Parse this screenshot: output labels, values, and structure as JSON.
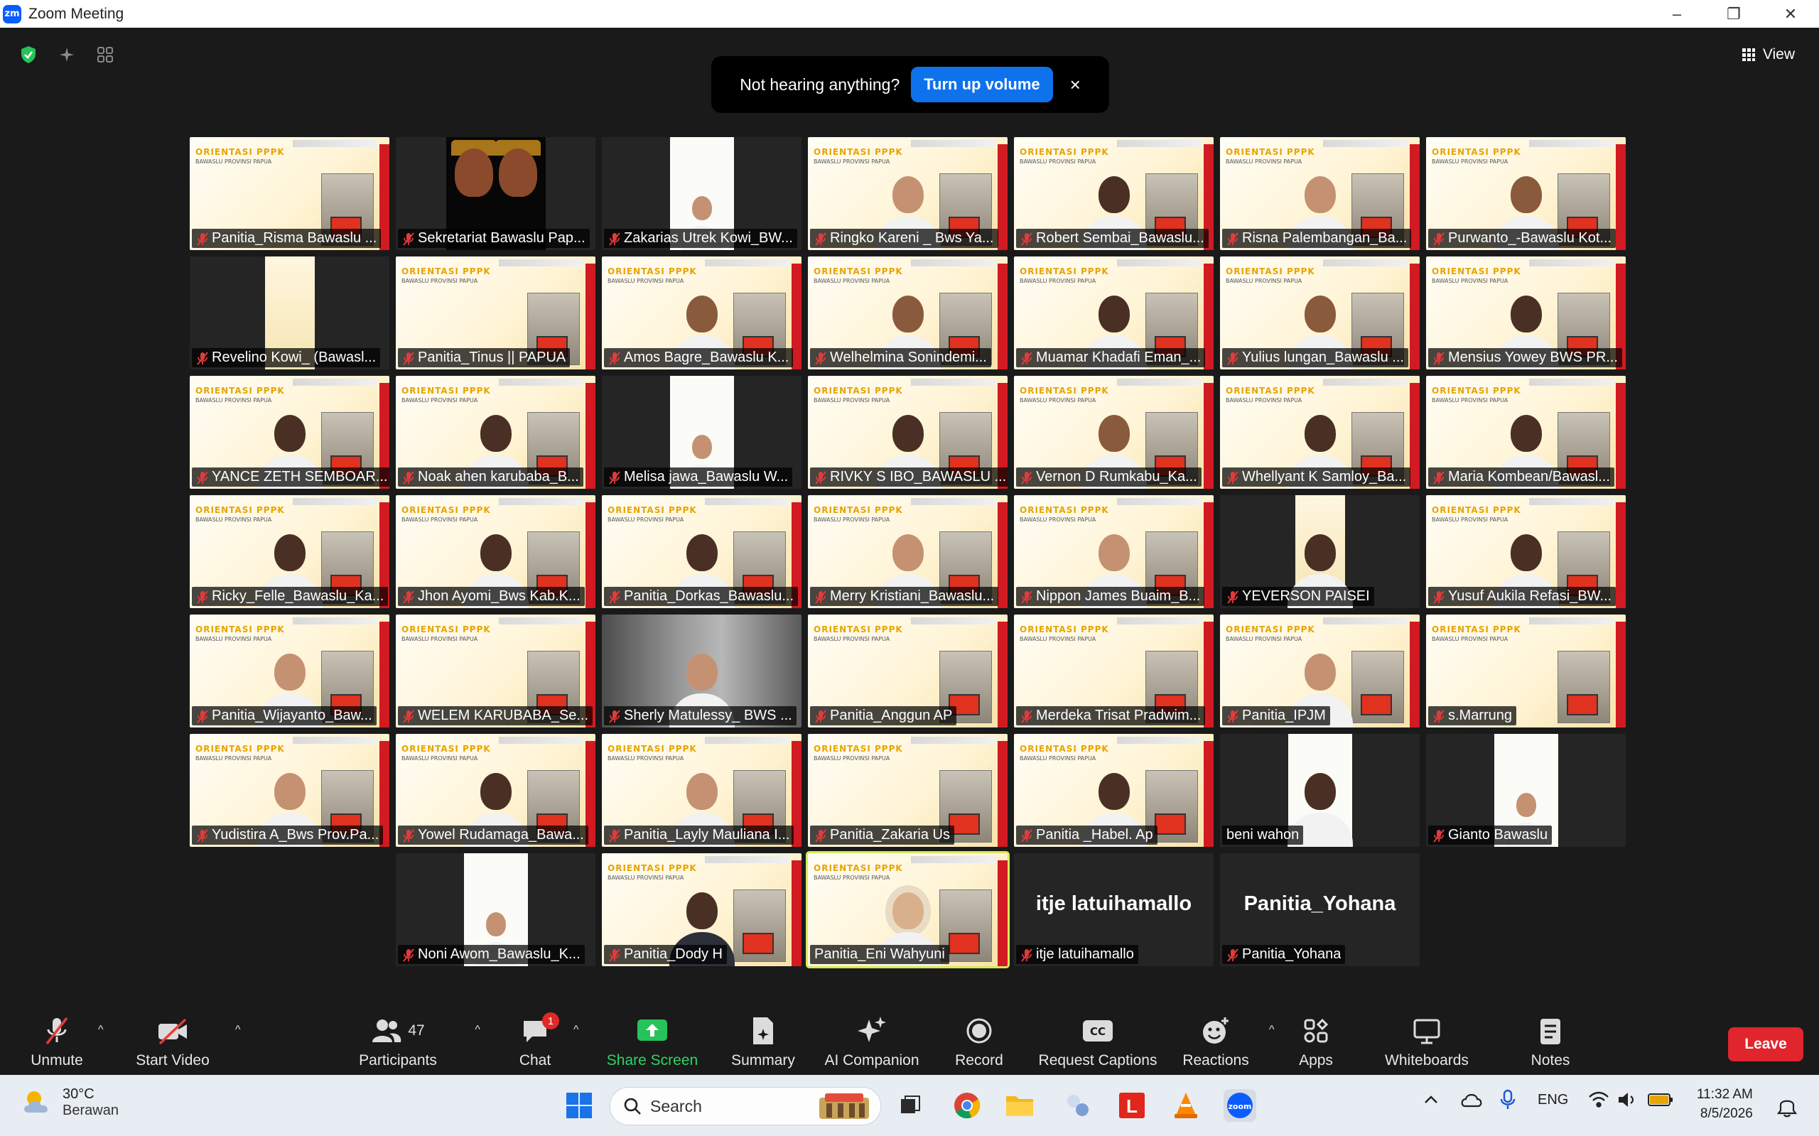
{
  "window": {
    "title": "Zoom Meeting",
    "logo_text": "zm"
  },
  "top_bar": {
    "view_label": "View"
  },
  "notice": {
    "message": "Not hearing anything?",
    "button_label": "Turn up volume",
    "close_label": "×"
  },
  "participants": [
    {
      "name": "Panitia_Risma Bawaslu ...",
      "muted": true,
      "bg": "banner",
      "person": "none"
    },
    {
      "name": "Sekretariat Bawaslu Pap...",
      "muted": true,
      "bg": "kids",
      "person": "none"
    },
    {
      "name": "Zakarias Utrek Kowi_BW...",
      "muted": true,
      "bg": "strip",
      "person": "sm"
    },
    {
      "name": "Ringko Kareni _ Bws Ya...",
      "muted": true,
      "bg": "banner",
      "person": "light"
    },
    {
      "name": "Robert Sembai_Bawaslu...",
      "muted": true,
      "bg": "banner",
      "person": "dark-skin"
    },
    {
      "name": "Risna Palembangan_Ba...",
      "muted": true,
      "bg": "banner",
      "person": "light"
    },
    {
      "name": "Purwanto_-Bawaslu Kot...",
      "muted": true,
      "bg": "banner",
      "person": "med"
    },
    {
      "name": "Revelino Kowi_ (Bawasl...",
      "muted": true,
      "bg": "strip2",
      "person": "none"
    },
    {
      "name": "Panitia_Tinus || PAPUA",
      "muted": true,
      "bg": "banner",
      "person": "none"
    },
    {
      "name": "Amos Bagre_Bawaslu K...",
      "muted": true,
      "bg": "banner",
      "person": "med"
    },
    {
      "name": "Welhelmina Sonindemi...",
      "muted": true,
      "bg": "banner",
      "person": "med"
    },
    {
      "name": "Muamar Khadafi Eman_...",
      "muted": true,
      "bg": "banner",
      "person": "dark-skin"
    },
    {
      "name": "Yulius lungan_Bawaslu ...",
      "muted": true,
      "bg": "banner",
      "person": "med"
    },
    {
      "name": "Mensius Yowey BWS PR...",
      "muted": true,
      "bg": "banner",
      "person": "dark-skin"
    },
    {
      "name": "YANCE ZETH SEMBOAR...",
      "muted": true,
      "bg": "banner",
      "person": "dark-skin"
    },
    {
      "name": "Noak ahen karubaba_B...",
      "muted": true,
      "bg": "banner",
      "person": "dark-skin"
    },
    {
      "name": "Melisa jawa_Bawaslu W...",
      "muted": true,
      "bg": "strip",
      "person": "sm"
    },
    {
      "name": "RIVKY S IBO_BAWASLU ...",
      "muted": true,
      "bg": "banner",
      "person": "dark-skin"
    },
    {
      "name": "Vernon D Rumkabu_Ka...",
      "muted": true,
      "bg": "banner",
      "person": "med"
    },
    {
      "name": "Whellyant K Samloy_Ba...",
      "muted": true,
      "bg": "banner",
      "person": "dark-skin"
    },
    {
      "name": "Maria Kombean/Bawasl...",
      "muted": true,
      "bg": "banner",
      "person": "dark-skin"
    },
    {
      "name": "Ricky_Felle_Bawaslu_Ka...",
      "muted": true,
      "bg": "banner",
      "person": "dark-skin"
    },
    {
      "name": "Jhon Ayomi_Bws Kab.K...",
      "muted": true,
      "bg": "banner",
      "person": "dark-skin"
    },
    {
      "name": "Panitia_Dorkas_Bawaslu...",
      "muted": true,
      "bg": "banner",
      "person": "dark-skin"
    },
    {
      "name": "Merry Kristiani_Bawaslu...",
      "muted": true,
      "bg": "banner",
      "person": "light"
    },
    {
      "name": "Nippon James Buaim_B...",
      "muted": true,
      "bg": "banner",
      "person": "light"
    },
    {
      "name": "YEVERSON PAISEI",
      "muted": true,
      "bg": "strip2",
      "person": "dark-skin"
    },
    {
      "name": "Yusuf Aukila Refasi_BW...",
      "muted": true,
      "bg": "banner",
      "person": "dark-skin"
    },
    {
      "name": "Panitia_Wijayanto_Baw...",
      "muted": true,
      "bg": "banner",
      "person": "light"
    },
    {
      "name": "WELEM KARUBABA_Se...",
      "muted": true,
      "bg": "banner",
      "person": "none"
    },
    {
      "name": "Sherly Matulessy_ BWS ...",
      "muted": true,
      "bg": "sherly",
      "person": "light"
    },
    {
      "name": "Panitia_Anggun AP",
      "muted": true,
      "bg": "banner",
      "person": "none"
    },
    {
      "name": "Merdeka Trisat Pradwim...",
      "muted": true,
      "bg": "banner",
      "person": "none"
    },
    {
      "name": "Panitia_IPJM",
      "muted": true,
      "bg": "banner",
      "person": "light"
    },
    {
      "name": "s.Marrung",
      "muted": true,
      "bg": "banner",
      "person": "none"
    },
    {
      "name": "Yudistira A_Bws Prov.Pa...",
      "muted": true,
      "bg": "banner",
      "person": "light"
    },
    {
      "name": "Yowel Rudamaga_Bawa...",
      "muted": true,
      "bg": "banner",
      "person": "dark-skin"
    },
    {
      "name": "Panitia_Layly Mauliana I...",
      "muted": true,
      "bg": "banner",
      "person": "light"
    },
    {
      "name": "Panitia_Zakaria Us",
      "muted": true,
      "bg": "banner",
      "person": "none"
    },
    {
      "name": "Panitia _Habel. Ap",
      "muted": true,
      "bg": "banner",
      "person": "dark-skin"
    },
    {
      "name": "beni wahon",
      "muted": false,
      "bg": "strip",
      "person": "dark-skin"
    },
    {
      "name": "Gianto Bawaslu",
      "muted": true,
      "bg": "strip",
      "person": "sm"
    },
    {
      "name": "",
      "muted": false,
      "bg": "empty",
      "person": "none"
    },
    {
      "name": "Noni Awom_Bawaslu_K...",
      "muted": true,
      "bg": "strip",
      "person": "sm"
    },
    {
      "name": "Panitia_Dody H",
      "muted": true,
      "bg": "banner",
      "person": "dark-shirt"
    },
    {
      "name": "Panitia_Eni Wahyuni",
      "muted": false,
      "bg": "banner",
      "person": "hijab",
      "speaking": true
    },
    {
      "name": "itje latuihamallo",
      "muted": true,
      "bg": "text",
      "person": "none",
      "big": "itje latuihamallo"
    },
    {
      "name": "Panitia_Yohana",
      "muted": true,
      "bg": "text",
      "person": "none",
      "big": "Panitia_Yohana"
    }
  ],
  "toolbar": {
    "unmute": "Unmute",
    "start_video": "Start Video",
    "participants": "Participants",
    "participant_count": "47",
    "chat": "Chat",
    "chat_badge": "1",
    "share_screen": "Share Screen",
    "summary": "Summary",
    "ai_companion": "AI Companion",
    "record": "Record",
    "request_captions": "Request Captions",
    "reactions": "Reactions",
    "apps": "Apps",
    "whiteboards": "Whiteboards",
    "notes": "Notes",
    "leave": "Leave"
  },
  "taskbar": {
    "temperature": "30°C",
    "weather": "Berawan",
    "search_label": "Search",
    "language": "ENG",
    "time": "11:32 AM",
    "date": "8/5/2026"
  },
  "banner_text": {
    "heading": "ORIENTASI PPPK",
    "sub": "BAWASLU PROVINSI PAPUA"
  },
  "colors": {
    "accent_blue": "#0e72ed",
    "leave_red": "#e0252c",
    "share_green": "#2fd463",
    "speaker_outline": "#d8e85a"
  }
}
